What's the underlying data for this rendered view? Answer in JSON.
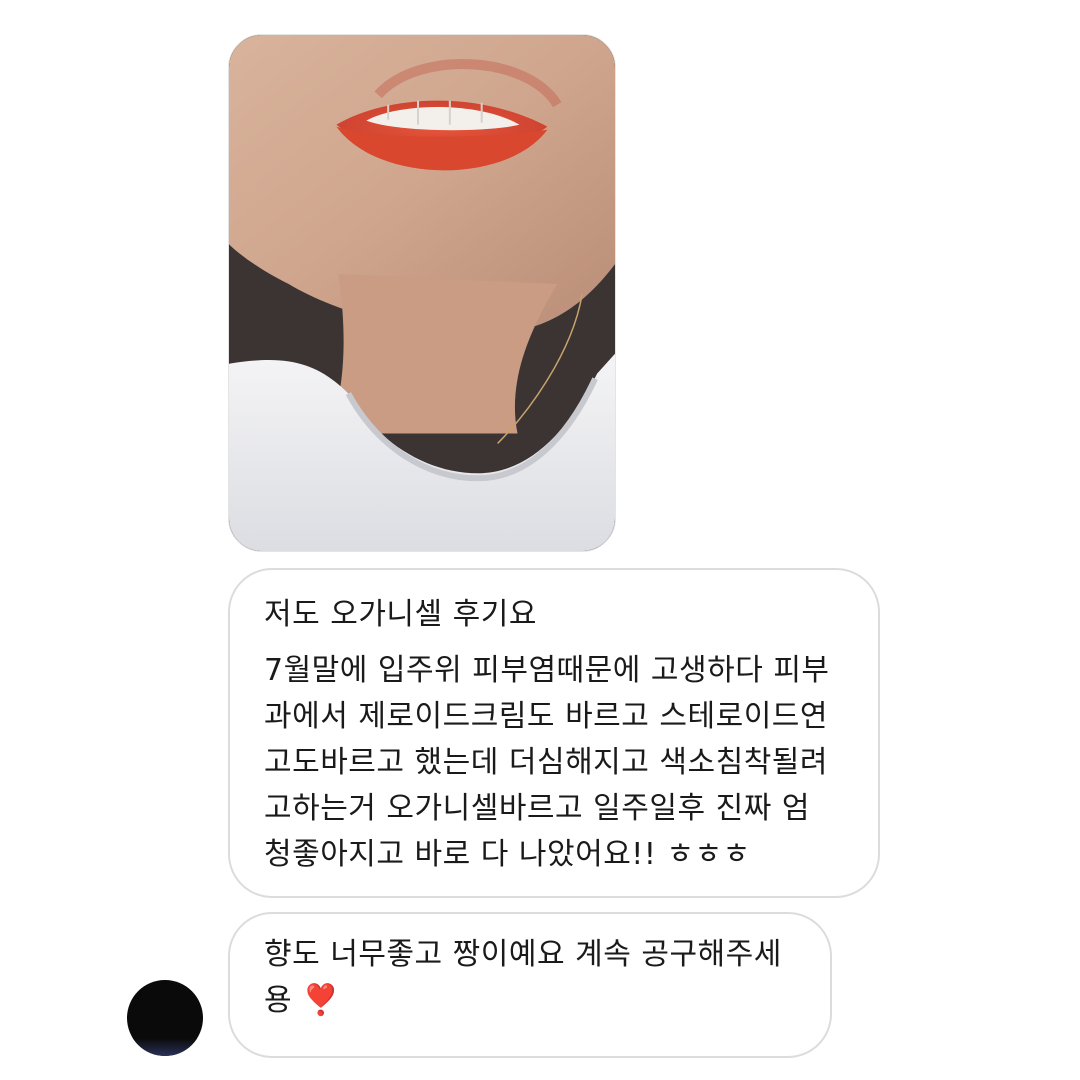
{
  "conversation": {
    "photo": {
      "alt": ""
    },
    "message_1": {
      "lines": [
        "저도 오가니셀 후기요",
        "7월말에 입주위 피부염때문에 고생하다 피부",
        "과에서 제로이드크림도 바르고 스테로이드연",
        "고도바르고 했는데 더심해지고 색소침착될려",
        "고하는거 오가니셀바르고 일주일후 진짜 엄",
        "청좋아지고 바로 다 나았어요!! ㅎㅎㅎ"
      ]
    },
    "message_2": {
      "lines": [
        "향도 너무좋고 짱이예요 계속 공구해주세",
        "용"
      ],
      "emoji": "❣️"
    }
  },
  "colors": {
    "bubble_border": "#dcdcdc",
    "text": "#1a1a1a",
    "heart": "#e0182d"
  },
  "icons": {
    "sender_avatar": "avatar",
    "heart": "heart-exclamation-icon"
  }
}
